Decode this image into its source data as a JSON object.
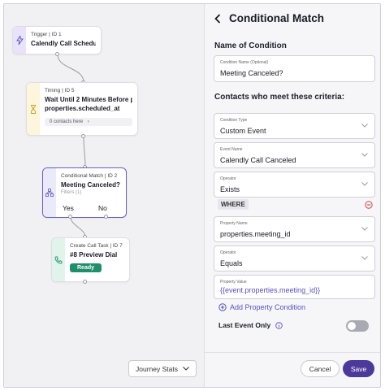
{
  "canvas": {
    "nodes": {
      "trigger": {
        "meta": "Trigger | ID 1",
        "title": "Calendly Call Scheduled"
      },
      "timing": {
        "meta": "Timing | ID 5",
        "title_line1": "Wait Until 2 Minutes Before p",
        "title_line2": "properties.scheduled_at",
        "contacts": "0 contacts here",
        "contacts_arrow": "›"
      },
      "condition": {
        "meta": "Conditional Match | ID 2",
        "title": "Meeting Canceled?",
        "filters": "Filters (1)",
        "yes": "Yes",
        "no": "No"
      },
      "call_task": {
        "meta": "Create Call Task | ID 7",
        "title": "#8 Preview Dial",
        "status": "Ready"
      }
    },
    "journey_stats": {
      "label": "Journey Stats"
    }
  },
  "panel": {
    "title": "Conditional Match",
    "name_section": "Name of Condition",
    "condition_name": {
      "label": "Condition Name (Optional)",
      "value": "Meeting Canceled?"
    },
    "criteria_section": "Contacts who meet these criteria:",
    "condition_type": {
      "label": "Condition Type",
      "value": "Custom Event"
    },
    "event_name": {
      "label": "Event Name",
      "value": "Calendly Call Canceled"
    },
    "operator1": {
      "label": "Operator",
      "value": "Exists"
    },
    "where": "WHERE",
    "property_name": {
      "label": "Property Name",
      "value": "properties.meeting_id"
    },
    "operator2": {
      "label": "Operator",
      "value": "Equals"
    },
    "property_value": {
      "label": "Property Value",
      "value": "{{event.properties.meeting_id}}"
    },
    "add_property": "Add Property Condition",
    "last_event": "Last Event Only",
    "last_event_on": false,
    "cancel": "Cancel",
    "save": "Save"
  },
  "colors": {
    "accent": "#4b3a9a",
    "trigger": "#e8e3fb",
    "timing": "#fdf6dc",
    "condition": "#ebeaf8",
    "call_task": "#e1f4ec",
    "ready": "#1f8f6a"
  },
  "icons": {
    "trigger": "lightning-icon",
    "timing": "hourglass-icon",
    "condition": "branch-icon",
    "call_task": "phone-icon",
    "back": "chevron-left-icon",
    "dropdown": "chevron-down-icon",
    "remove": "minus-circle-icon",
    "add": "plus-circle-icon",
    "info": "info-icon"
  }
}
